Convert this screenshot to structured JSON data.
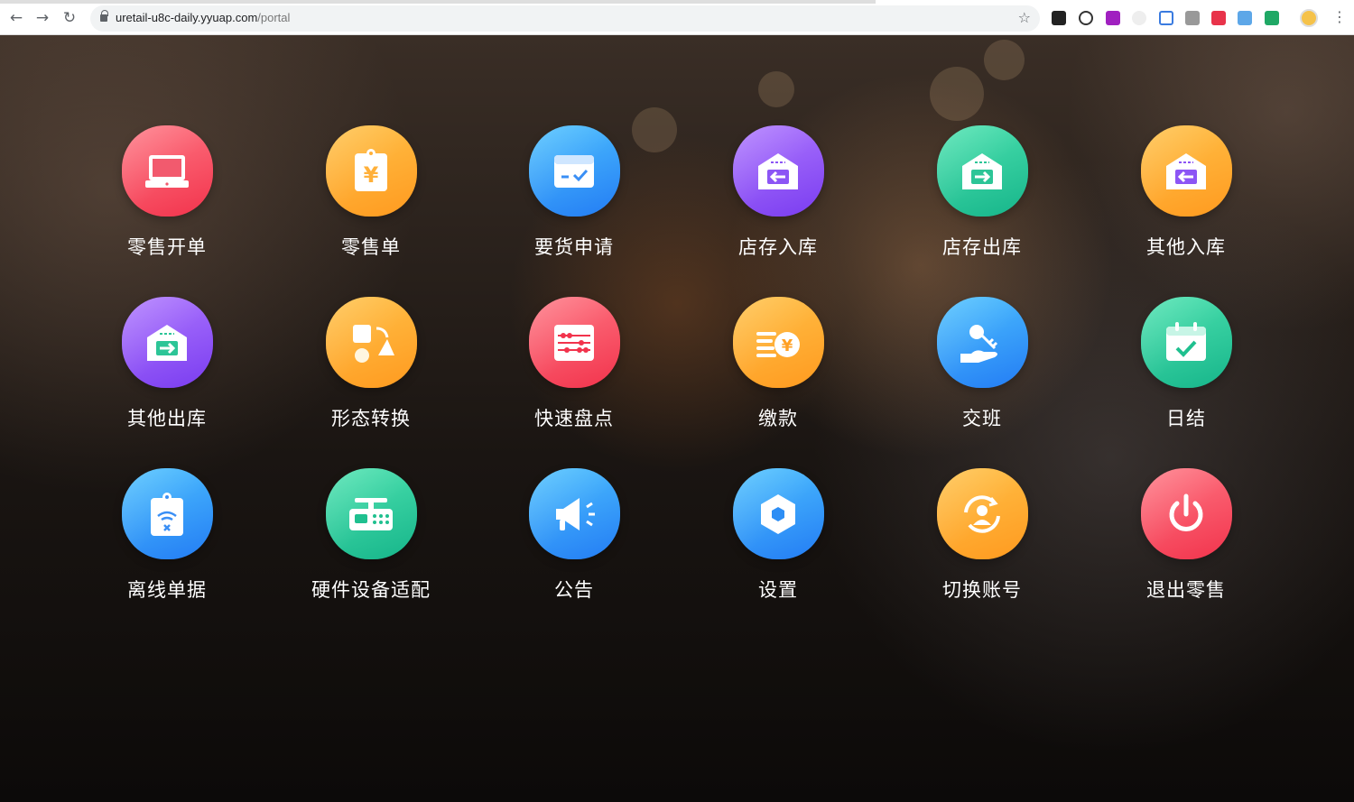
{
  "browser": {
    "url_host": "uretail-u8c-daily.yyuap.com",
    "url_path": "/portal"
  },
  "tiles": [
    {
      "label": "零售开单",
      "icon": "laptop-icon",
      "color": "red"
    },
    {
      "label": "零售单",
      "icon": "receipt-yuan-icon",
      "color": "orange"
    },
    {
      "label": "要货申请",
      "icon": "box-check-icon",
      "color": "blue"
    },
    {
      "label": "店存入库",
      "icon": "warehouse-in-icon",
      "color": "purple"
    },
    {
      "label": "店存出库",
      "icon": "warehouse-out-icon",
      "color": "green"
    },
    {
      "label": "其他入库",
      "icon": "warehouse-in-icon",
      "color": "orange"
    },
    {
      "label": "其他出库",
      "icon": "warehouse-out-icon",
      "color": "purple"
    },
    {
      "label": "形态转换",
      "icon": "shape-transform-icon",
      "color": "orange"
    },
    {
      "label": "快速盘点",
      "icon": "abacus-icon",
      "color": "red"
    },
    {
      "label": "缴款",
      "icon": "coins-yuan-icon",
      "color": "orange"
    },
    {
      "label": "交班",
      "icon": "hand-key-icon",
      "color": "blue"
    },
    {
      "label": "日结",
      "icon": "calendar-check-icon",
      "color": "green"
    },
    {
      "label": "离线单据",
      "icon": "offline-doc-icon",
      "color": "blue"
    },
    {
      "label": "硬件设备适配",
      "icon": "scale-icon",
      "color": "green"
    },
    {
      "label": "公告",
      "icon": "megaphone-icon",
      "color": "blue"
    },
    {
      "label": "设置",
      "icon": "hexagon-settings-icon",
      "color": "blue"
    },
    {
      "label": "切换账号",
      "icon": "switch-user-icon",
      "color": "orange"
    },
    {
      "label": "退出零售",
      "icon": "power-icon",
      "color": "red"
    }
  ]
}
